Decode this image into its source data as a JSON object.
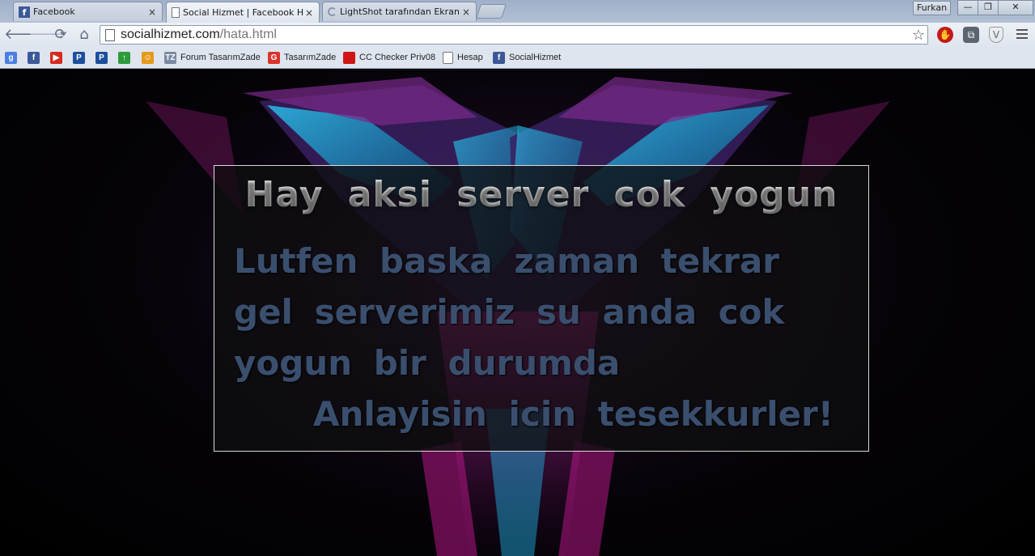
{
  "tabs": [
    {
      "title": "Facebook",
      "icon": "facebook-icon",
      "close": "×",
      "active": false
    },
    {
      "title": "Social Hizmet | Facebook Hile",
      "icon": "page-icon",
      "close": "×",
      "active": true
    },
    {
      "title": "LightShot tarafından Ekran G",
      "icon": "loading-icon",
      "close": "×",
      "active": false
    }
  ],
  "profile": "Furkan",
  "window_controls": {
    "minimize": "—",
    "restore": "❐",
    "close": "✕"
  },
  "nav": {
    "back": "🡐",
    "forward": "🡒",
    "reload": "⟳",
    "home": "⌂"
  },
  "omnibox": {
    "host": "socialhizmet.com",
    "path": "/hata.html",
    "star": "☆"
  },
  "bookmarks": [
    {
      "label": "",
      "icon": "google-plus-icon",
      "glyph": "g",
      "color": "#4a7fe0"
    },
    {
      "label": "",
      "icon": "facebook-icon",
      "glyph": "f",
      "color": "#3b5998"
    },
    {
      "label": "",
      "icon": "youtube-icon",
      "glyph": "▶",
      "color": "#d52b1e"
    },
    {
      "label": "",
      "icon": "paypal-icon",
      "glyph": "P",
      "color": "#1d4f9c"
    },
    {
      "label": "",
      "icon": "paypal-icon",
      "glyph": "P",
      "color": "#1d4f9c"
    },
    {
      "label": "",
      "icon": "upload-arrow-icon",
      "glyph": "↑",
      "color": "#2e9b3b"
    },
    {
      "label": "",
      "icon": "face-icon",
      "glyph": "☺",
      "color": "#e59a1c"
    },
    {
      "label": "Forum TasarımZade",
      "icon": "tz-icon",
      "glyph": "TZ",
      "color": "#7a8aa2"
    },
    {
      "label": "TasarımZade",
      "icon": "g-red-icon",
      "glyph": "G",
      "color": "#d9342b"
    },
    {
      "label": "CC Checker Priv08",
      "icon": "red-square-icon",
      "glyph": "",
      "color": "#d01515"
    },
    {
      "label": "Hesap",
      "icon": "page-icon",
      "glyph": "",
      "color": "#ffffff"
    },
    {
      "label": "SocialHizmet",
      "icon": "facebook-icon",
      "glyph": "f",
      "color": "#3b5998"
    }
  ],
  "content": {
    "headline": "Hay aksi server cok yogun",
    "message": "Lutfen baska zaman tekrar gel serverimiz su anda cok yogun bir durumda",
    "thanks": "Anlayisin icin tesekkurler!"
  },
  "colors": {
    "message_text": "#3a4f6e",
    "panel_border": "#d8d8d8",
    "art_cyan": "#1fb6e8",
    "art_magenta": "#c2188f"
  }
}
